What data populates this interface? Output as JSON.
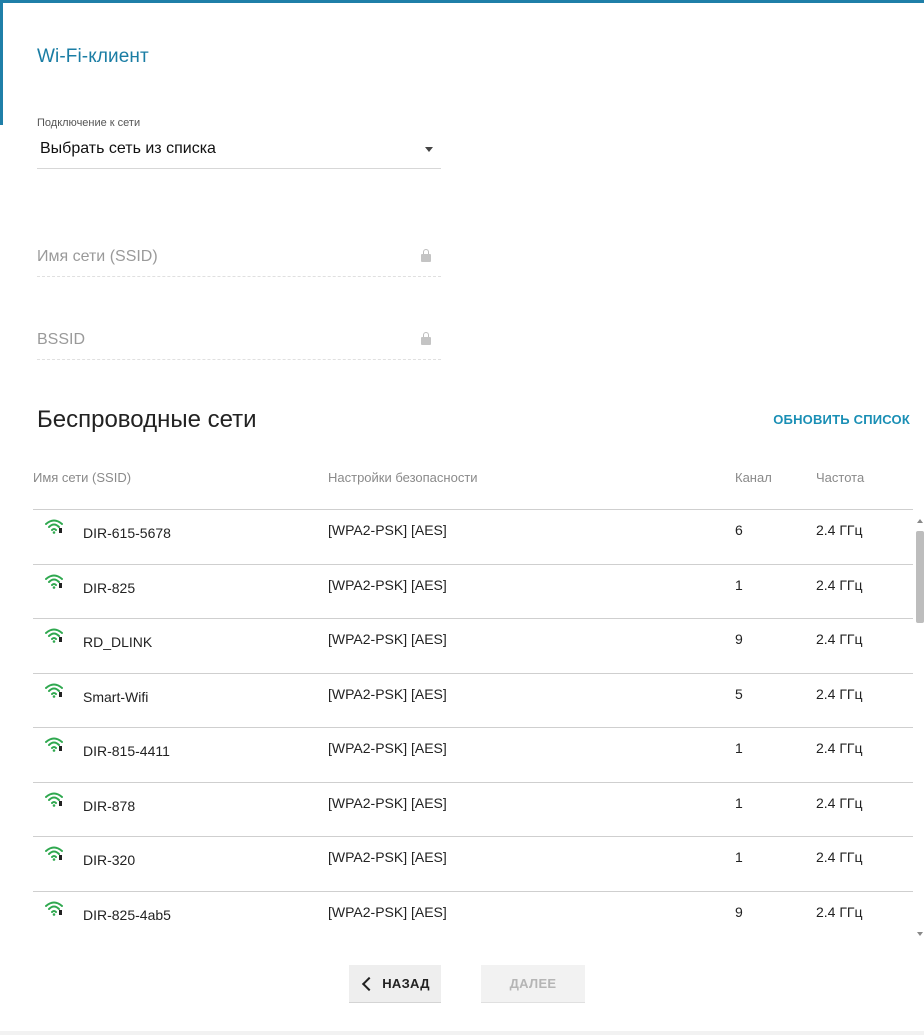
{
  "page": {
    "title": "Wi-Fi-клиент"
  },
  "connection": {
    "label": "Подключение к сети",
    "value": "Выбрать сеть из списка"
  },
  "ssid_field": {
    "label": "Имя сети (SSID)"
  },
  "bssid_field": {
    "label": "BSSID"
  },
  "networks": {
    "title": "Беспроводные сети",
    "refresh_label": "ОБНОВИТЬ СПИСОК",
    "columns": {
      "ssid": "Имя сети (SSID)",
      "security": "Настройки безопасности",
      "channel": "Канал",
      "frequency": "Частота"
    },
    "rows": [
      {
        "ssid": "DIR-615-5678",
        "security": "[WPA2-PSK] [AES]",
        "channel": "6",
        "frequency": "2.4 ГГц"
      },
      {
        "ssid": "DIR-825",
        "security": "[WPA2-PSK] [AES]",
        "channel": "1",
        "frequency": "2.4 ГГц"
      },
      {
        "ssid": "RD_DLINK",
        "security": "[WPA2-PSK] [AES]",
        "channel": "9",
        "frequency": "2.4 ГГц"
      },
      {
        "ssid": "Smart-Wifi",
        "security": "[WPA2-PSK] [AES]",
        "channel": "5",
        "frequency": "2.4 ГГц"
      },
      {
        "ssid": "DIR-815-4411",
        "security": "[WPA2-PSK] [AES]",
        "channel": "1",
        "frequency": "2.4 ГГц"
      },
      {
        "ssid": "DIR-878",
        "security": "[WPA2-PSK] [AES]",
        "channel": "1",
        "frequency": "2.4 ГГц"
      },
      {
        "ssid": "DIR-320",
        "security": "[WPA2-PSK] [AES]",
        "channel": "1",
        "frequency": "2.4 ГГц"
      },
      {
        "ssid": "DIR-825-4ab5",
        "security": "[WPA2-PSK] [AES]",
        "channel": "9",
        "frequency": "2.4 ГГц"
      }
    ]
  },
  "buttons": {
    "back": "НАЗАД",
    "next": "ДАЛЕЕ"
  },
  "colors": {
    "accent": "#1a7da4",
    "link": "#1a8fb5",
    "wifi_icon": "#2fa84f"
  },
  "icons": {
    "row_icon": "wifi-signal-icon",
    "field_lock": "lock-icon",
    "select_caret": "chevron-down-icon",
    "back_chevron": "chevron-left-icon"
  }
}
